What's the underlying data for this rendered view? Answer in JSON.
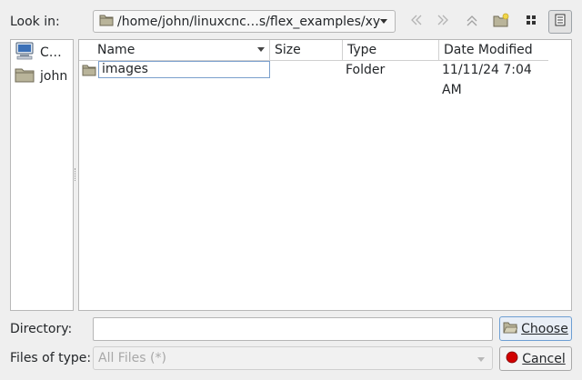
{
  "look_in": {
    "label": "Look in:",
    "path": "/home/john/linuxcnc…s/flex_examples/xyz"
  },
  "toolbar": {
    "back_icon": "back-arrow-icon",
    "forward_icon": "forward-arrow-icon",
    "parent_icon": "parent-directory-icon",
    "new_folder_icon": "new-folder-icon",
    "list_view_icon": "list-view-icon",
    "detail_view_icon": "detail-view-icon"
  },
  "sidebar": {
    "items": [
      {
        "label": "C…",
        "icon": "computer-icon"
      },
      {
        "label": "john",
        "icon": "folder-icon"
      }
    ]
  },
  "file_list": {
    "columns": [
      "Name",
      "Size",
      "Type",
      "Date Modified"
    ],
    "rows": [
      {
        "name": "images",
        "size": "",
        "type": "Folder",
        "date": "11/11/24 7:04 AM",
        "icon": "folder-icon"
      }
    ]
  },
  "directory": {
    "label": "Directory:",
    "value": ""
  },
  "files_of_type": {
    "label": "Files of type:",
    "value": "All Files (*)"
  },
  "buttons": {
    "choose": "Choose",
    "cancel": "Cancel"
  },
  "colors": {
    "window_bg": "#efefef",
    "accent_border": "#6d9fd3",
    "folder": "#b9b49a",
    "cancel_dot": "#d10000"
  }
}
